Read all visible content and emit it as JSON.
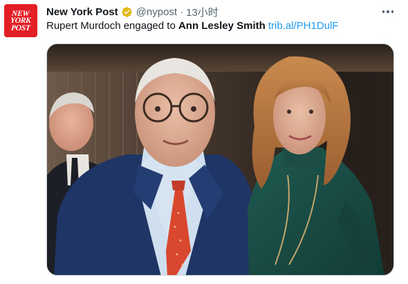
{
  "account": {
    "display_name": "New York Post",
    "handle": "@nypost",
    "separator": "·",
    "timestamp": "13小时",
    "verified": true,
    "avatar_lines": [
      "NEW",
      "YORK",
      "POST"
    ],
    "verified_color": "#e2b719"
  },
  "tweet": {
    "text_before": "Rupert Murdoch engaged to ",
    "text_bold": "Ann Lesley Smith",
    "link": "trib.al/PH1DulF",
    "link_color": "#1d9bf0"
  },
  "media": {
    "type": "photo"
  },
  "colors": {
    "brand_red": "#e31e24",
    "secondary_text": "#536471"
  },
  "icons": {
    "more": "more-horizontal-icon",
    "verified": "verified-badge-icon"
  }
}
